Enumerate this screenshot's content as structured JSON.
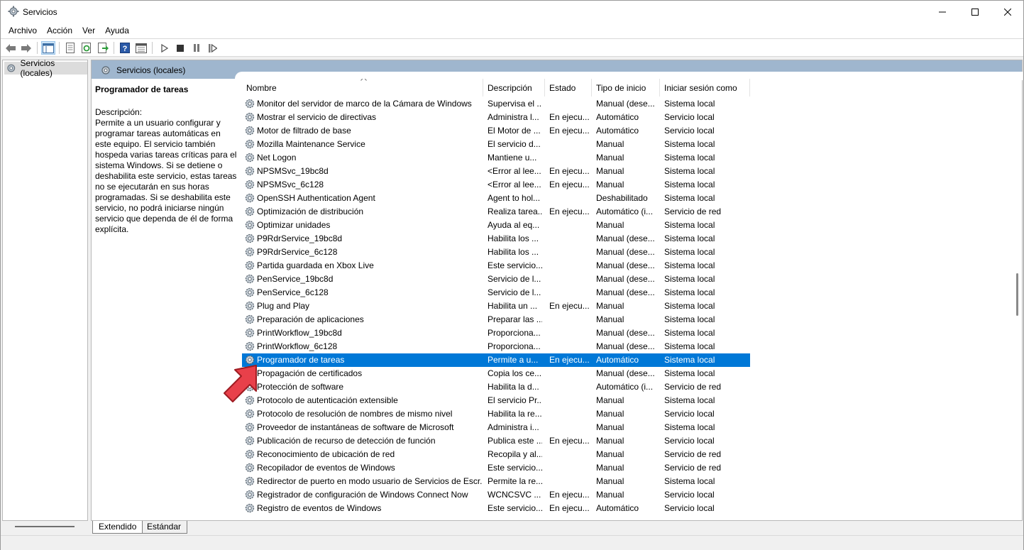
{
  "window": {
    "title": "Servicios",
    "icon": "services-gear-icon"
  },
  "menu": [
    "Archivo",
    "Acción",
    "Ver",
    "Ayuda"
  ],
  "toolbar": {
    "buttons": [
      "back-arrow-icon",
      "forward-arrow-icon",
      "console-tree-icon",
      "properties-icon",
      "refresh-icon",
      "export-list-icon",
      "help-icon",
      "extended-view-icon",
      "play-icon",
      "stop-icon",
      "pause-icon",
      "resume-icon"
    ]
  },
  "tree": {
    "item": "Servicios (locales)"
  },
  "pane": {
    "header": "Servicios (locales)",
    "selected_service_title": "Programador de tareas",
    "description_label": "Descripción:",
    "description_text": "Permite a un usuario configurar y programar tareas automáticas en este equipo. El servicio también hospeda varias tareas críticas para el sistema Windows. Si se detiene o deshabilita este servicio, estas tareas no se ejecutarán en sus horas programadas. Si se deshabilita este servicio, no podrá iniciarse ningún servicio que dependa de él de forma explícita."
  },
  "columns": [
    "Nombre",
    "Descripción",
    "Estado",
    "Tipo de inicio",
    "Iniciar sesión como"
  ],
  "rows": [
    [
      "Monitor del servidor de marco de la Cámara de Windows",
      "Supervisa el ...",
      "",
      "Manual (dese...",
      "Sistema local"
    ],
    [
      "Mostrar el servicio de directivas",
      "Administra l...",
      "En ejecu...",
      "Automático",
      "Servicio local"
    ],
    [
      "Motor de filtrado de base",
      "El Motor de ...",
      "En ejecu...",
      "Automático",
      "Servicio local"
    ],
    [
      "Mozilla Maintenance Service",
      "El servicio d...",
      "",
      "Manual",
      "Sistema local"
    ],
    [
      "Net Logon",
      "Mantiene u...",
      "",
      "Manual",
      "Sistema local"
    ],
    [
      "NPSMSvc_19bc8d",
      "<Error al lee...",
      "En ejecu...",
      "Manual",
      "Sistema local"
    ],
    [
      "NPSMSvc_6c128",
      "<Error al lee...",
      "En ejecu...",
      "Manual",
      "Sistema local"
    ],
    [
      "OpenSSH Authentication Agent",
      "Agent to hol...",
      "",
      "Deshabilitado",
      "Sistema local"
    ],
    [
      "Optimización de distribución",
      "Realiza tarea...",
      "En ejecu...",
      "Automático (i...",
      "Servicio de red"
    ],
    [
      "Optimizar unidades",
      "Ayuda al eq...",
      "",
      "Manual",
      "Sistema local"
    ],
    [
      "P9RdrService_19bc8d",
      "Habilita los ...",
      "",
      "Manual (dese...",
      "Sistema local"
    ],
    [
      "P9RdrService_6c128",
      "Habilita los ...",
      "",
      "Manual (dese...",
      "Sistema local"
    ],
    [
      "Partida guardada en Xbox Live",
      "Este servicio...",
      "",
      "Manual (dese...",
      "Sistema local"
    ],
    [
      "PenService_19bc8d",
      "Servicio de l...",
      "",
      "Manual (dese...",
      "Sistema local"
    ],
    [
      "PenService_6c128",
      "Servicio de l...",
      "",
      "Manual (dese...",
      "Sistema local"
    ],
    [
      "Plug and Play",
      "Habilita un ...",
      "En ejecu...",
      "Manual",
      "Sistema local"
    ],
    [
      "Preparación de aplicaciones",
      "Preparar las ...",
      "",
      "Manual",
      "Sistema local"
    ],
    [
      "PrintWorkflow_19bc8d",
      "Proporciona...",
      "",
      "Manual (dese...",
      "Sistema local"
    ],
    [
      "PrintWorkflow_6c128",
      "Proporciona...",
      "",
      "Manual (dese...",
      "Sistema local"
    ],
    [
      "Programador de tareas",
      "Permite a u...",
      "En ejecu...",
      "Automático",
      "Sistema local"
    ],
    [
      "Propagación de certificados",
      "Copia los ce...",
      "",
      "Manual (dese...",
      "Sistema local"
    ],
    [
      "Protección de software",
      "Habilita la d...",
      "",
      "Automático (i...",
      "Servicio de red"
    ],
    [
      "Protocolo de autenticación extensible",
      "El servicio Pr...",
      "",
      "Manual",
      "Sistema local"
    ],
    [
      "Protocolo de resolución de nombres de mismo nivel",
      "Habilita la re...",
      "",
      "Manual",
      "Servicio local"
    ],
    [
      "Proveedor de instantáneas de software de Microsoft",
      "Administra i...",
      "",
      "Manual",
      "Sistema local"
    ],
    [
      "Publicación de recurso de detección de función",
      "Publica este ...",
      "En ejecu...",
      "Manual",
      "Servicio local"
    ],
    [
      "Reconocimiento de ubicación de red",
      "Recopila y al...",
      "",
      "Manual",
      "Servicio de red"
    ],
    [
      "Recopilador de eventos de Windows",
      "Este servicio...",
      "",
      "Manual",
      "Servicio de red"
    ],
    [
      "Redirector de puerto en modo usuario de Servicios de Escr...",
      "Permite la re...",
      "",
      "Manual",
      "Sistema local"
    ],
    [
      "Registrador de configuración de Windows Connect Now",
      "WCNCSVC ...",
      "En ejecu...",
      "Manual",
      "Servicio local"
    ],
    [
      "Registro de eventos de Windows",
      "Este servicio...",
      "En ejecu...",
      "Automático",
      "Servicio local"
    ]
  ],
  "selected_row_index": 19,
  "tabs": [
    "Extendido",
    "Estándar"
  ],
  "colors": {
    "selection": "#0078d7",
    "pane_header": "#9fb6ce",
    "pointer_arrow": "#e8404a"
  }
}
